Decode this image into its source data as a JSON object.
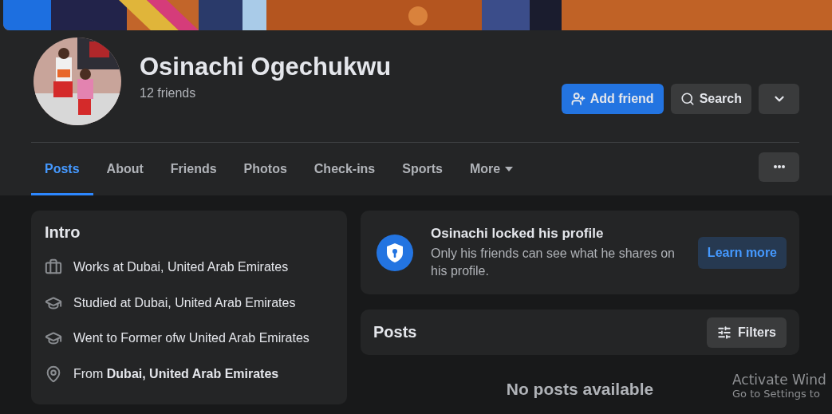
{
  "profile": {
    "name": "Osinachi Ogechukwu",
    "friends_count": "12 friends"
  },
  "actions": [
    {
      "kind": "primary",
      "label": "Add friend"
    },
    {
      "kind": "secondary",
      "label": "Search"
    },
    {
      "kind": "icon"
    }
  ],
  "tabs": [
    {
      "label": "Posts",
      "selected": true
    },
    {
      "label": "About",
      "selected": false
    },
    {
      "label": "Friends",
      "selected": false
    },
    {
      "label": "Photos",
      "selected": false
    },
    {
      "label": "Check-ins",
      "selected": false
    },
    {
      "label": "Sports",
      "selected": false
    },
    {
      "label": "More",
      "selected": false,
      "kind": "dropdown"
    }
  ],
  "intro": {
    "title": "Intro",
    "items": [
      {
        "kind": "work",
        "text": "Works at Dubai, United Arab Emirates"
      },
      {
        "kind": "study",
        "text": "Studied at Dubai, United Arab Emirates"
      },
      {
        "kind": "study",
        "text": "Went to Former ofw United Arab Emirates"
      },
      {
        "kind": "location",
        "text": "From **Dubai, United Arab Emirates**"
      }
    ]
  },
  "lock_notice": {
    "title": "Osinachi locked his profile",
    "text": "Only his friends can see what he shares on his profile.",
    "button": "Learn more"
  },
  "posts": {
    "title": "Posts",
    "filter_button": "Filters",
    "empty_text": "No posts available"
  },
  "os_overlay": {
    "title": "Activate Wind",
    "subtitle": "Go to Settings to"
  }
}
